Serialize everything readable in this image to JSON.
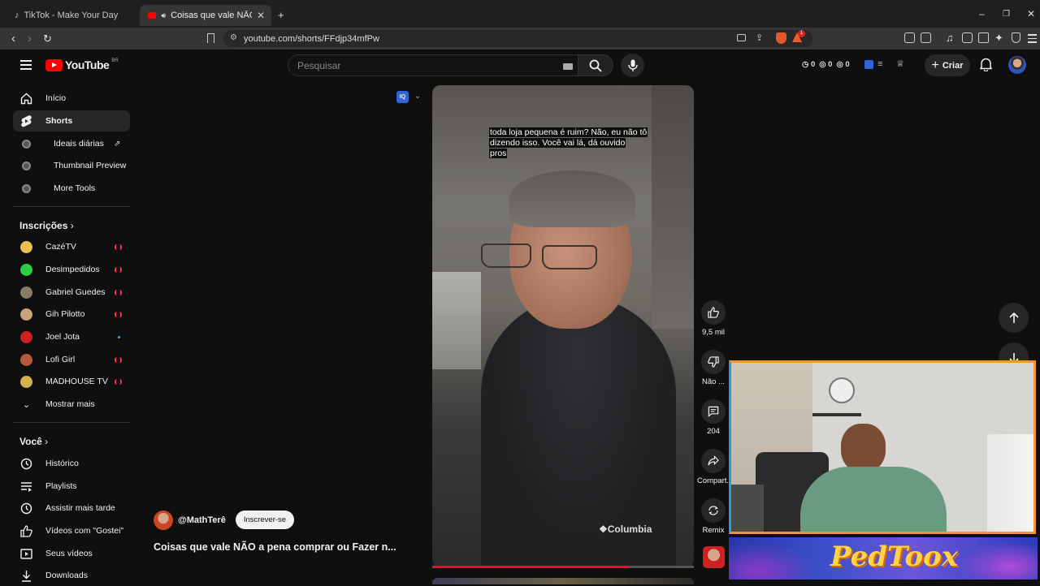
{
  "browser": {
    "tabs": [
      {
        "title": "TikTok - Make Your Day",
        "active": false
      },
      {
        "title": "Coisas que vale NÃO a pena comprar",
        "active": true
      }
    ],
    "url": "youtube.com/shorts/FFdjp34mfPw",
    "extension_badge": "1"
  },
  "header": {
    "logo_text": "YouTube",
    "logo_region": "BR",
    "search_placeholder": "Pesquisar",
    "stats": [
      "0",
      "0",
      "0"
    ],
    "create_label": "Criar"
  },
  "sidebar": {
    "main": [
      {
        "label": "Início",
        "icon": "home-icon"
      },
      {
        "label": "Shorts",
        "icon": "shorts-icon",
        "active": true
      },
      {
        "label": "Ideais diárias",
        "icon": "tool-icon"
      },
      {
        "label": "Thumbnail Preview",
        "icon": "tool-icon"
      },
      {
        "label": "More Tools",
        "icon": "tool-icon"
      }
    ],
    "subscriptions_title": "Inscrições",
    "subscriptions": [
      {
        "label": "CazéTV",
        "color": "#e8c24a"
      },
      {
        "label": "Desimpedidos",
        "color": "#2ecc40"
      },
      {
        "label": "Gabriel Guedes",
        "color": "#8a7a66"
      },
      {
        "label": "Gih Pilotto",
        "color": "#c9a37a"
      },
      {
        "label": "Joel Jota",
        "color": "#cc2222"
      },
      {
        "label": "Lofi Girl",
        "color": "#b55a3a"
      },
      {
        "label": "MADHOUSE TV",
        "color": "#d4b04a"
      }
    ],
    "show_more": "Mostrar mais",
    "you_title": "Você",
    "you": [
      {
        "label": "Histórico",
        "icon": "history-icon"
      },
      {
        "label": "Playlists",
        "icon": "playlists-icon"
      },
      {
        "label": "Assistir mais tarde",
        "icon": "watch-later-icon"
      },
      {
        "label": "Vídeos com \"Gostei\"",
        "icon": "like-icon"
      },
      {
        "label": "Seus vídeos",
        "icon": "your-videos-icon"
      },
      {
        "label": "Downloads",
        "icon": "download-icon"
      }
    ]
  },
  "short": {
    "caption_lines": [
      "toda loja pequena é ruim? Não, eu não tô",
      "dizendo isso. Você vai lá, dá ouvido",
      "pros"
    ],
    "overlay_badge": "IQ",
    "channel": "@MathTerê",
    "subscribe_label": "Inscrever-se",
    "title": "Coisas que vale NÃO a pena comprar ou Fazer n...",
    "progress": 0.75,
    "actions": {
      "likes": "9,5 mil",
      "dislike": "Não ...",
      "comments": "204",
      "share": "Compart...",
      "remix": "Remix"
    }
  },
  "overlay": {
    "brand": "PedToox"
  }
}
